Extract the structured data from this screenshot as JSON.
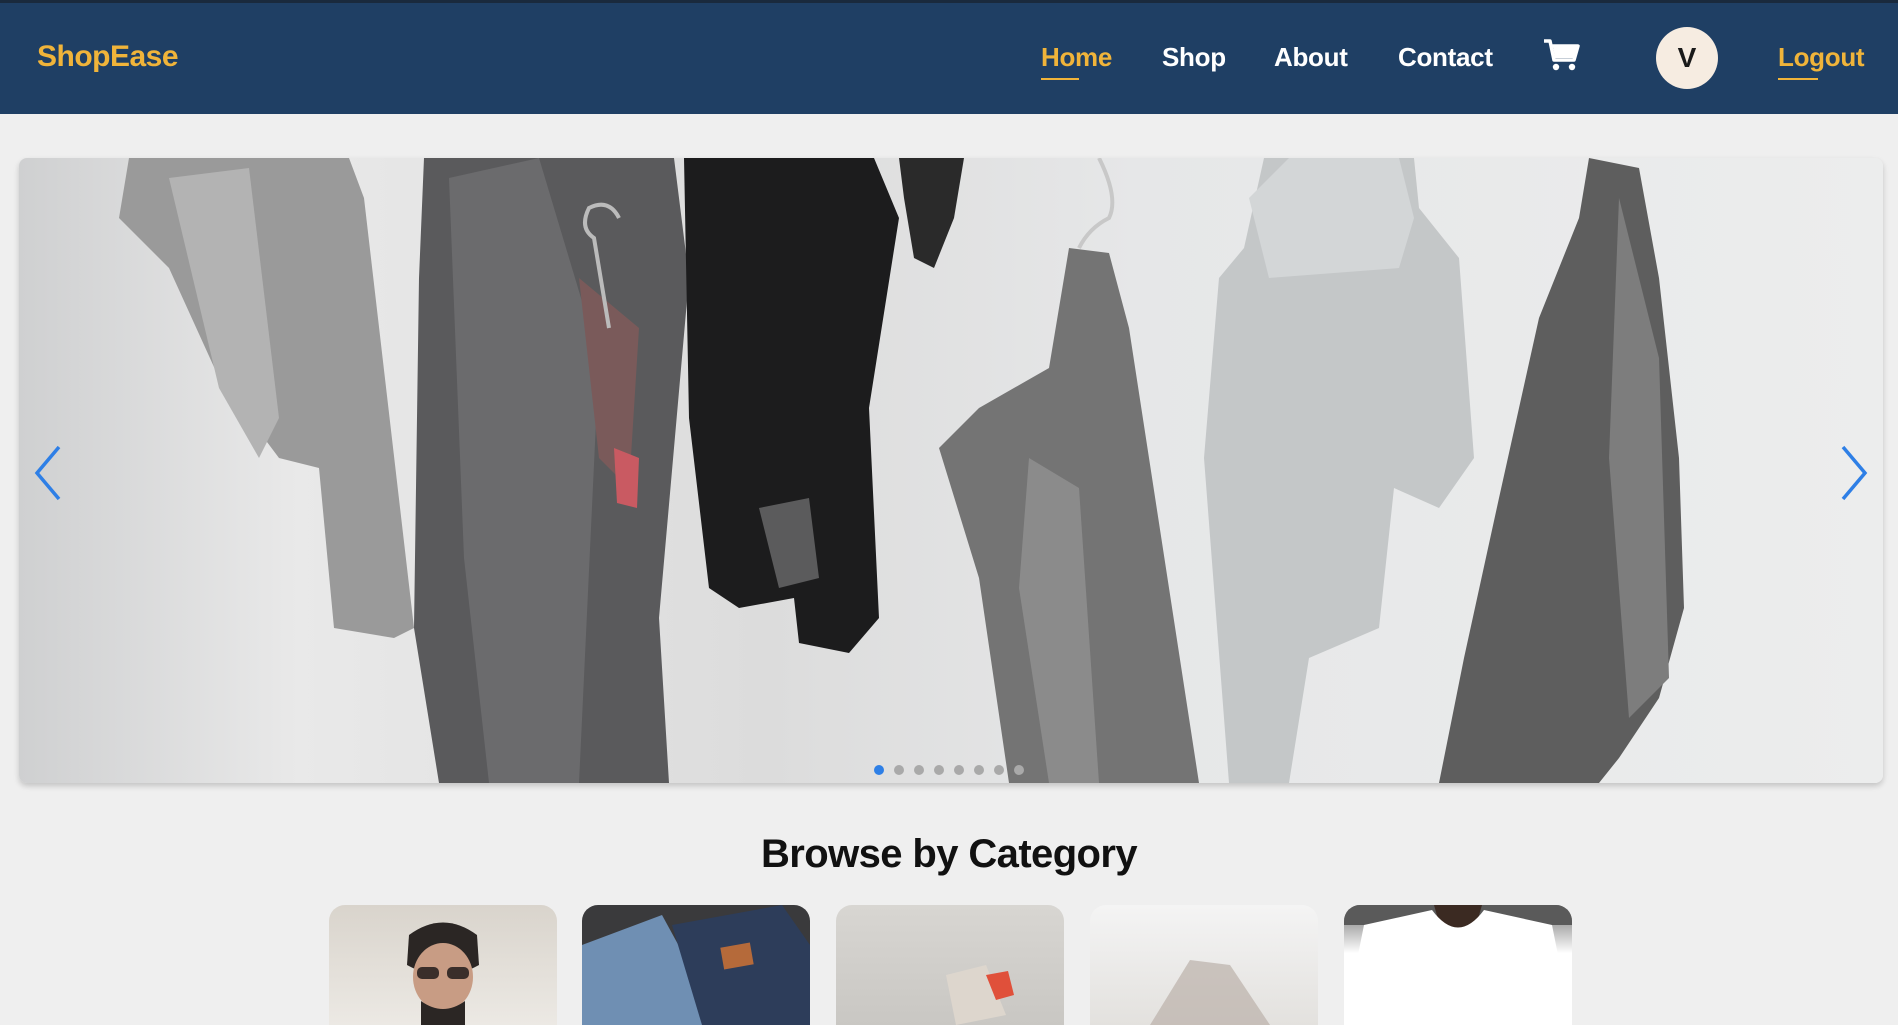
{
  "navbar": {
    "brand": "ShopEase",
    "links": [
      {
        "label": "Home",
        "active": true
      },
      {
        "label": "Shop",
        "active": false
      },
      {
        "label": "About",
        "active": false
      },
      {
        "label": "Contact",
        "active": false
      }
    ],
    "cart_icon": "shopping-cart-icon",
    "avatar_initial": "V",
    "logout_label": "Logout"
  },
  "hero": {
    "slide_count": 8,
    "active_slide": 1,
    "prev_icon": "chevron-left-icon",
    "next_icon": "chevron-right-icon"
  },
  "categories": {
    "title": "Browse by Category",
    "card_count": 5
  },
  "colors": {
    "nav_bg": "#1f3f64",
    "accent": "#f0b43a",
    "arrow": "#2e7fe6",
    "page_bg": "#efefef"
  }
}
